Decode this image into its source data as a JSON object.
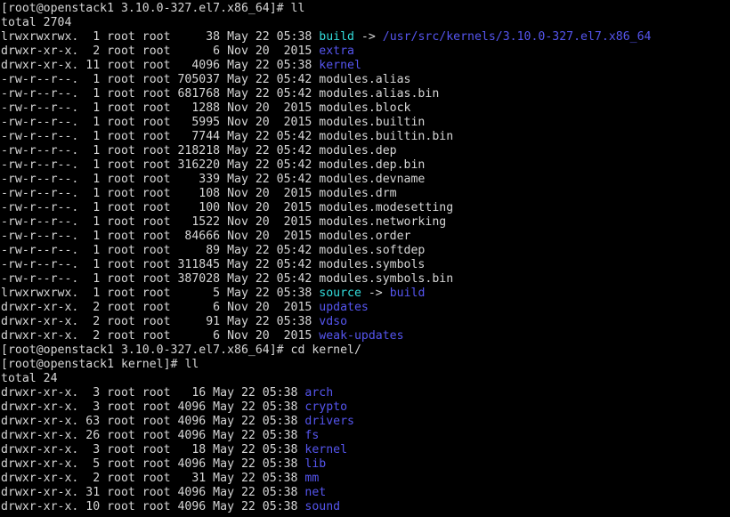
{
  "terminal": {
    "title": "root@openstack1 terminal",
    "colors": {
      "background": "#000000",
      "foreground": "#d6d6d6",
      "directory": "#5555ee",
      "symlink": "#33dddd",
      "symlink_target": "#5555ee"
    },
    "prompts": {
      "prompt_modules": "[root@openstack1 3.10.0-327.el7.x86_64]#",
      "prompt_kernel": "[root@openstack1 kernel]#"
    },
    "commands": {
      "ll": "ll",
      "cd_kernel": "cd kernel/"
    },
    "lines": [
      {
        "type": "prompt",
        "prompt": "[root@openstack1 3.10.0-327.el7.x86_64]#",
        "command": " ll"
      },
      {
        "type": "plain",
        "text": "total 2704"
      },
      {
        "type": "entry",
        "perms": "lrwxrwxrwx.",
        "links": "1",
        "owner": "root",
        "group": "root",
        "size": "38",
        "month": "May",
        "day": "22",
        "time": "05:38",
        "name": "build",
        "color": "link",
        "arrow": " -> ",
        "target": "/usr/src/kernels/3.10.0-327.el7.x86_64",
        "target_color": "target"
      },
      {
        "type": "entry",
        "perms": "drwxr-xr-x.",
        "links": "2",
        "owner": "root",
        "group": "root",
        "size": "6",
        "month": "Nov",
        "day": "20",
        "time": "2015",
        "name": "extra",
        "color": "dir"
      },
      {
        "type": "entry",
        "perms": "drwxr-xr-x.",
        "links": "11",
        "owner": "root",
        "group": "root",
        "size": "4096",
        "month": "May",
        "day": "22",
        "time": "05:38",
        "name": "kernel",
        "color": "dir"
      },
      {
        "type": "entry",
        "perms": "-rw-r--r--.",
        "links": "1",
        "owner": "root",
        "group": "root",
        "size": "705037",
        "month": "May",
        "day": "22",
        "time": "05:42",
        "name": "modules.alias",
        "color": "default"
      },
      {
        "type": "entry",
        "perms": "-rw-r--r--.",
        "links": "1",
        "owner": "root",
        "group": "root",
        "size": "681768",
        "month": "May",
        "day": "22",
        "time": "05:42",
        "name": "modules.alias.bin",
        "color": "default"
      },
      {
        "type": "entry",
        "perms": "-rw-r--r--.",
        "links": "1",
        "owner": "root",
        "group": "root",
        "size": "1288",
        "month": "Nov",
        "day": "20",
        "time": "2015",
        "name": "modules.block",
        "color": "default"
      },
      {
        "type": "entry",
        "perms": "-rw-r--r--.",
        "links": "1",
        "owner": "root",
        "group": "root",
        "size": "5995",
        "month": "Nov",
        "day": "20",
        "time": "2015",
        "name": "modules.builtin",
        "color": "default"
      },
      {
        "type": "entry",
        "perms": "-rw-r--r--.",
        "links": "1",
        "owner": "root",
        "group": "root",
        "size": "7744",
        "month": "May",
        "day": "22",
        "time": "05:42",
        "name": "modules.builtin.bin",
        "color": "default"
      },
      {
        "type": "entry",
        "perms": "-rw-r--r--.",
        "links": "1",
        "owner": "root",
        "group": "root",
        "size": "218218",
        "month": "May",
        "day": "22",
        "time": "05:42",
        "name": "modules.dep",
        "color": "default"
      },
      {
        "type": "entry",
        "perms": "-rw-r--r--.",
        "links": "1",
        "owner": "root",
        "group": "root",
        "size": "316220",
        "month": "May",
        "day": "22",
        "time": "05:42",
        "name": "modules.dep.bin",
        "color": "default"
      },
      {
        "type": "entry",
        "perms": "-rw-r--r--.",
        "links": "1",
        "owner": "root",
        "group": "root",
        "size": "339",
        "month": "May",
        "day": "22",
        "time": "05:42",
        "name": "modules.devname",
        "color": "default"
      },
      {
        "type": "entry",
        "perms": "-rw-r--r--.",
        "links": "1",
        "owner": "root",
        "group": "root",
        "size": "108",
        "month": "Nov",
        "day": "20",
        "time": "2015",
        "name": "modules.drm",
        "color": "default"
      },
      {
        "type": "entry",
        "perms": "-rw-r--r--.",
        "links": "1",
        "owner": "root",
        "group": "root",
        "size": "100",
        "month": "Nov",
        "day": "20",
        "time": "2015",
        "name": "modules.modesetting",
        "color": "default"
      },
      {
        "type": "entry",
        "perms": "-rw-r--r--.",
        "links": "1",
        "owner": "root",
        "group": "root",
        "size": "1522",
        "month": "Nov",
        "day": "20",
        "time": "2015",
        "name": "modules.networking",
        "color": "default"
      },
      {
        "type": "entry",
        "perms": "-rw-r--r--.",
        "links": "1",
        "owner": "root",
        "group": "root",
        "size": "84666",
        "month": "Nov",
        "day": "20",
        "time": "2015",
        "name": "modules.order",
        "color": "default"
      },
      {
        "type": "entry",
        "perms": "-rw-r--r--.",
        "links": "1",
        "owner": "root",
        "group": "root",
        "size": "89",
        "month": "May",
        "day": "22",
        "time": "05:42",
        "name": "modules.softdep",
        "color": "default"
      },
      {
        "type": "entry",
        "perms": "-rw-r--r--.",
        "links": "1",
        "owner": "root",
        "group": "root",
        "size": "311845",
        "month": "May",
        "day": "22",
        "time": "05:42",
        "name": "modules.symbols",
        "color": "default"
      },
      {
        "type": "entry",
        "perms": "-rw-r--r--.",
        "links": "1",
        "owner": "root",
        "group": "root",
        "size": "387028",
        "month": "May",
        "day": "22",
        "time": "05:42",
        "name": "modules.symbols.bin",
        "color": "default"
      },
      {
        "type": "entry",
        "perms": "lrwxrwxrwx.",
        "links": "1",
        "owner": "root",
        "group": "root",
        "size": "5",
        "month": "May",
        "day": "22",
        "time": "05:38",
        "name": "source",
        "color": "link",
        "arrow": " -> ",
        "target": "build",
        "target_color": "target"
      },
      {
        "type": "entry",
        "perms": "drwxr-xr-x.",
        "links": "2",
        "owner": "root",
        "group": "root",
        "size": "6",
        "month": "Nov",
        "day": "20",
        "time": "2015",
        "name": "updates",
        "color": "dir"
      },
      {
        "type": "entry",
        "perms": "drwxr-xr-x.",
        "links": "2",
        "owner": "root",
        "group": "root",
        "size": "91",
        "month": "May",
        "day": "22",
        "time": "05:38",
        "name": "vdso",
        "color": "dir"
      },
      {
        "type": "entry",
        "perms": "drwxr-xr-x.",
        "links": "2",
        "owner": "root",
        "group": "root",
        "size": "6",
        "month": "Nov",
        "day": "20",
        "time": "2015",
        "name": "weak-updates",
        "color": "dir"
      },
      {
        "type": "prompt",
        "prompt": "[root@openstack1 3.10.0-327.el7.x86_64]#",
        "command": " cd kernel/"
      },
      {
        "type": "prompt",
        "prompt": "[root@openstack1 kernel]#",
        "command": " ll"
      },
      {
        "type": "plain",
        "text": "total 24"
      },
      {
        "type": "entry2",
        "perms": "drwxr-xr-x.",
        "links": "3",
        "owner": "root",
        "group": "root",
        "size": "16",
        "month": "May",
        "day": "22",
        "time": "05:38",
        "name": "arch",
        "color": "dir"
      },
      {
        "type": "entry2",
        "perms": "drwxr-xr-x.",
        "links": "3",
        "owner": "root",
        "group": "root",
        "size": "4096",
        "month": "May",
        "day": "22",
        "time": "05:38",
        "name": "crypto",
        "color": "dir"
      },
      {
        "type": "entry2",
        "perms": "drwxr-xr-x.",
        "links": "63",
        "owner": "root",
        "group": "root",
        "size": "4096",
        "month": "May",
        "day": "22",
        "time": "05:38",
        "name": "drivers",
        "color": "dir"
      },
      {
        "type": "entry2",
        "perms": "drwxr-xr-x.",
        "links": "26",
        "owner": "root",
        "group": "root",
        "size": "4096",
        "month": "May",
        "day": "22",
        "time": "05:38",
        "name": "fs",
        "color": "dir"
      },
      {
        "type": "entry2",
        "perms": "drwxr-xr-x.",
        "links": "3",
        "owner": "root",
        "group": "root",
        "size": "18",
        "month": "May",
        "day": "22",
        "time": "05:38",
        "name": "kernel",
        "color": "dir"
      },
      {
        "type": "entry2",
        "perms": "drwxr-xr-x.",
        "links": "5",
        "owner": "root",
        "group": "root",
        "size": "4096",
        "month": "May",
        "day": "22",
        "time": "05:38",
        "name": "lib",
        "color": "dir"
      },
      {
        "type": "entry2",
        "perms": "drwxr-xr-x.",
        "links": "2",
        "owner": "root",
        "group": "root",
        "size": "31",
        "month": "May",
        "day": "22",
        "time": "05:38",
        "name": "mm",
        "color": "dir"
      },
      {
        "type": "entry2",
        "perms": "drwxr-xr-x.",
        "links": "31",
        "owner": "root",
        "group": "root",
        "size": "4096",
        "month": "May",
        "day": "22",
        "time": "05:38",
        "name": "net",
        "color": "dir"
      },
      {
        "type": "entry2",
        "perms": "drwxr-xr-x.",
        "links": "10",
        "owner": "root",
        "group": "root",
        "size": "4096",
        "month": "May",
        "day": "22",
        "time": "05:38",
        "name": "sound",
        "color": "dir"
      }
    ]
  }
}
